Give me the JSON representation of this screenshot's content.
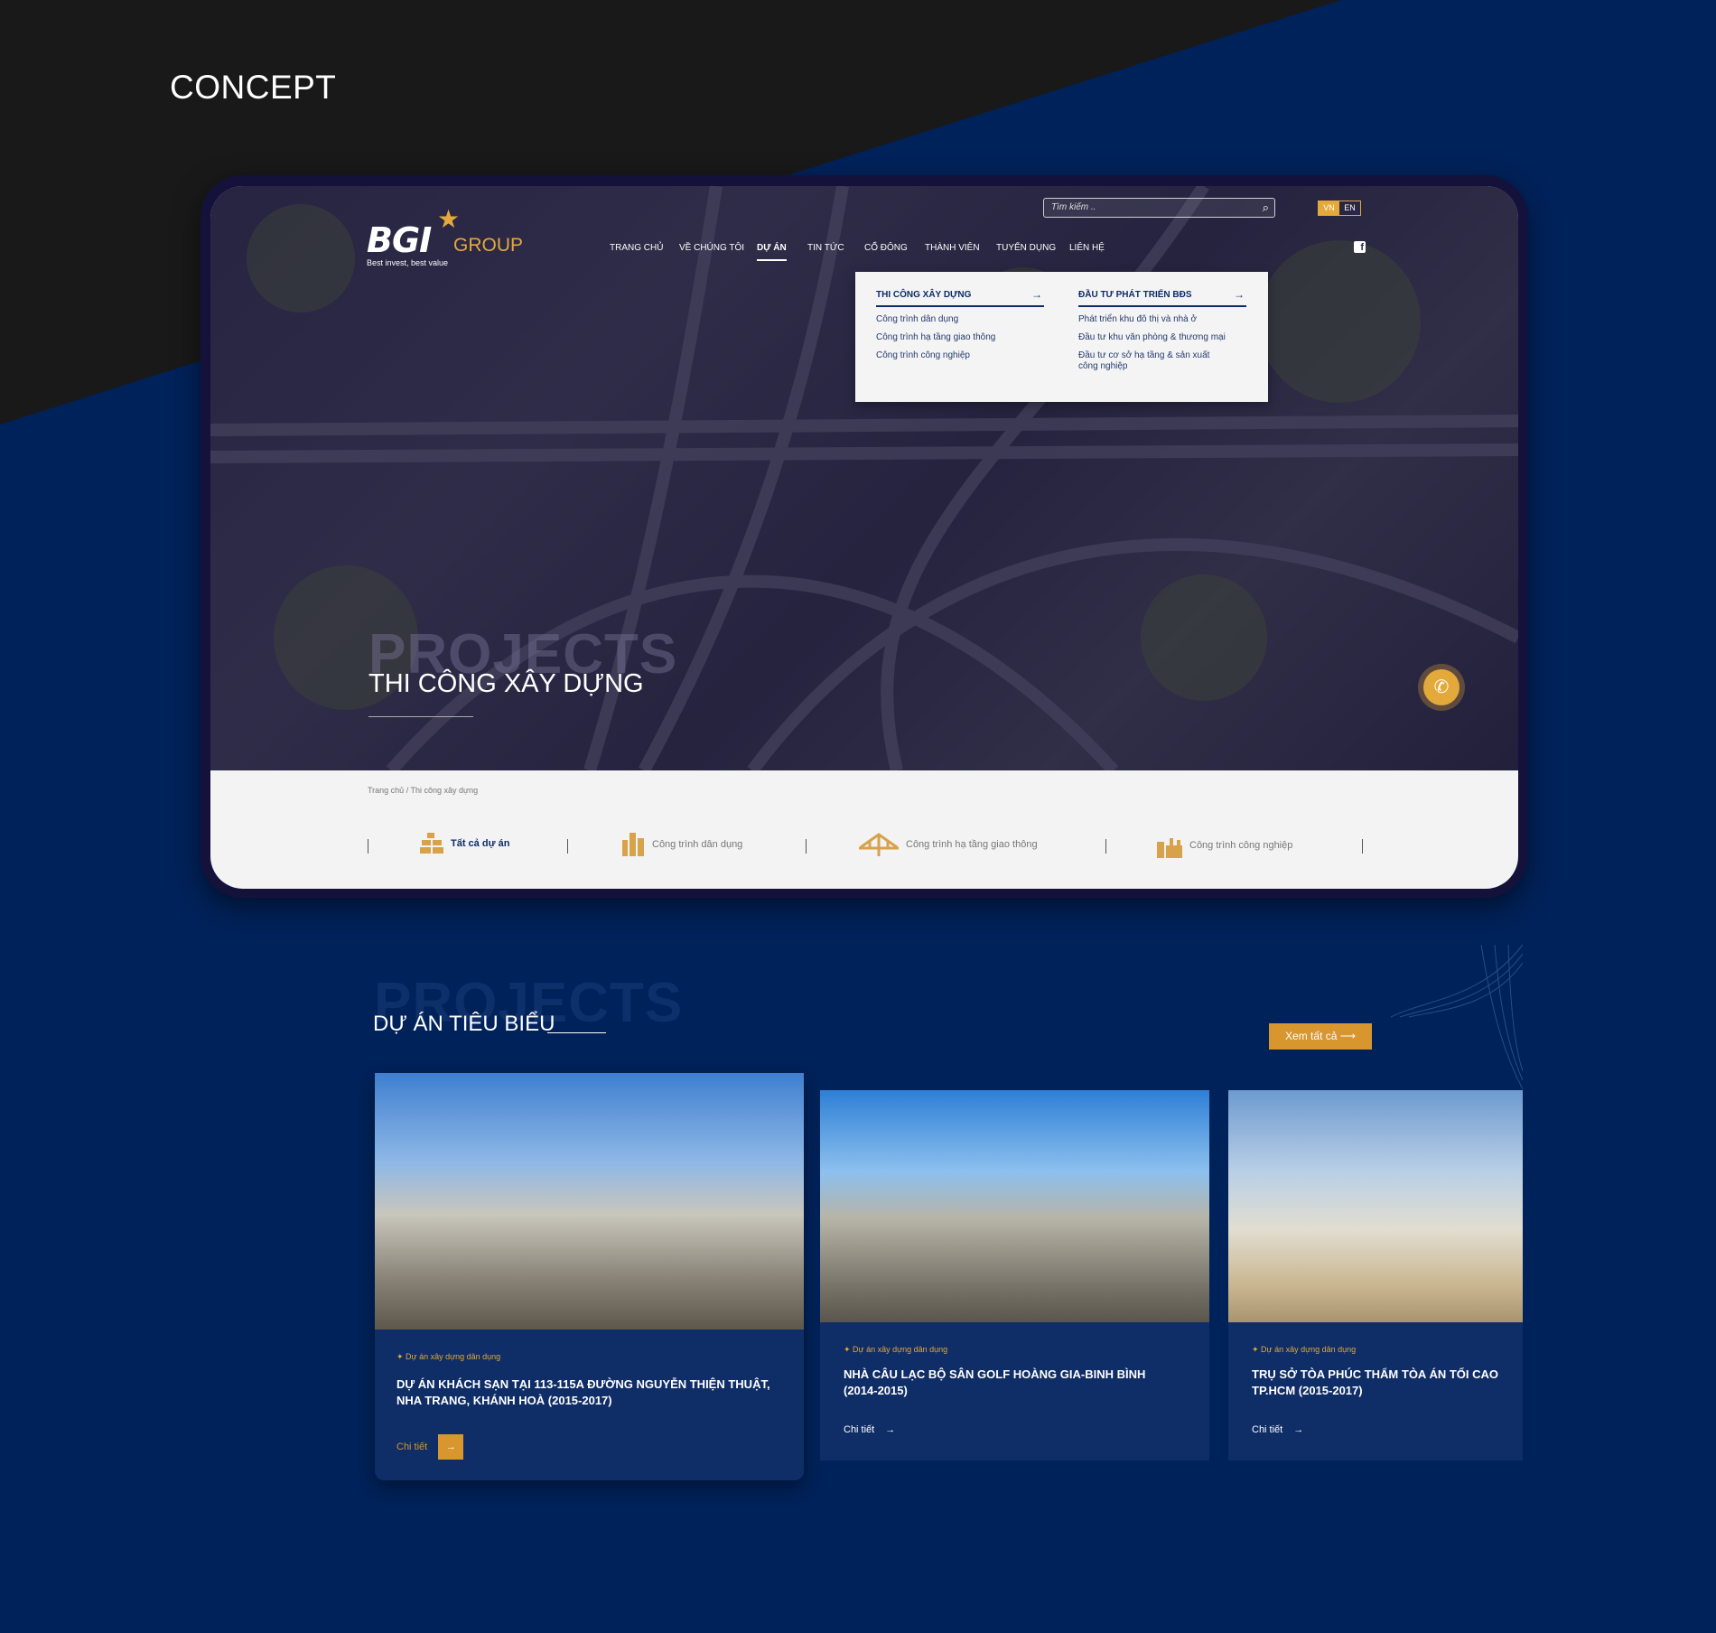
{
  "page": {
    "heading": "CONCEPT"
  },
  "header": {
    "logo": {
      "brand": "BGI",
      "group": "GROUP",
      "tagline": "Best invest, best value"
    },
    "search": {
      "placeholder": "Tìm kiếm .."
    },
    "lang": {
      "vn": "VN",
      "en": "EN",
      "active": "VN"
    },
    "nav": [
      {
        "label": "TRANG CHỦ"
      },
      {
        "label": "VỀ CHÚNG TÔI"
      },
      {
        "label": "DỰ ÁN",
        "active": true
      },
      {
        "label": "TIN TỨC"
      },
      {
        "label": "CỔ ĐÔNG"
      },
      {
        "label": "THÀNH VIÊN"
      },
      {
        "label": "TUYỂN DỤNG"
      },
      {
        "label": "LIÊN HỆ"
      }
    ],
    "social_icon": "facebook-icon"
  },
  "dropdown": {
    "columns": [
      {
        "title": "THI CÔNG XÂY DỰNG",
        "items": [
          "Công trình dân dụng",
          "Công trình hạ tầng giao thông",
          "Công trình công nghiệp"
        ]
      },
      {
        "title": "ĐẦU TƯ PHÁT TRIỂN BĐS",
        "items": [
          "Phát triển khu đô thị và nhà ở",
          "Đầu tư khu văn phòng & thương mại",
          "Đầu tư cơ sở hạ tầng & sản xuất công nghiệp"
        ]
      }
    ]
  },
  "hero": {
    "watermark": "PROJECTS",
    "title": "THI CÔNG XÂY DỰNG"
  },
  "breadcrumb": "Trang chủ / Thi công xây dựng",
  "categories": [
    {
      "label": "Tất cả dự án",
      "icon": "bricks-icon",
      "active": true
    },
    {
      "label": "Công trình dân dụng",
      "icon": "buildings-icon"
    },
    {
      "label": "Công trình hạ tầng giao thông",
      "icon": "bridge-icon"
    },
    {
      "label": "Công trình công nghiệp",
      "icon": "factory-icon"
    }
  ],
  "section": {
    "watermark": "PROJECTS",
    "title": "DỰ ÁN TIÊU BIỂU",
    "see_all": "Xem tất cả"
  },
  "projects": [
    {
      "category": "Dự án xây dựng dân dụng",
      "title": "DỰ ÁN KHÁCH SẠN TẠI 113-115A ĐƯỜNG NGUYỄN THIỆN THUẬT, NHA TRANG, KHÁNH HOÀ (2015-2017)",
      "more": "Chi tiết"
    },
    {
      "category": "Dự án xây dựng dân dụng",
      "title": "NHÀ CÂU LẠC BỘ SÂN GOLF HOÀNG GIA-BINH BÌNH (2014-2015)",
      "more": "Chi tiết"
    },
    {
      "category": "Dự án xây dựng dân dụng",
      "title": "TRỤ SỞ TÒA PHÚC THẨM TÒA ÁN TỐI CAO TP.HCM (2015-2017)",
      "more": "Chi tiết"
    }
  ],
  "colors": {
    "navy": "#00225a",
    "gold": "#e3a93a",
    "card": "#0f2d66"
  }
}
